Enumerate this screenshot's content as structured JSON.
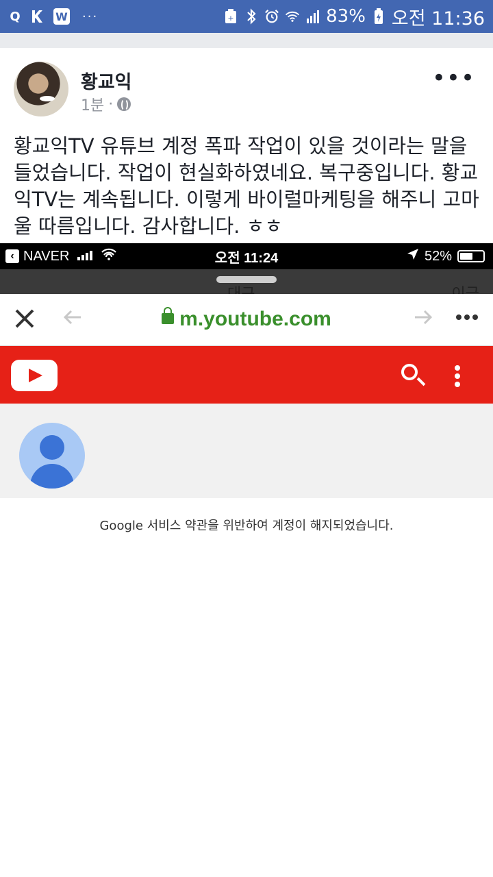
{
  "status_bar": {
    "apps": [
      "Q",
      "W"
    ],
    "more": "···",
    "battery": "83%",
    "time": "오전 11:36"
  },
  "post": {
    "author": "황교익",
    "time": "1분",
    "separator": "·",
    "more": "•••",
    "text": "황교익TV 유튜브 계정 폭파 작업이 있을 것이라는 말을 들었습니다. 작업이 현실화하였네요. 복구중입니다. 황교익TV는 계속됩니다. 이렇게 바이럴마케팅을 해주니 고마울 따름입니다. 감사합니다. ㅎㅎ"
  },
  "screenshot": {
    "status_bar": {
      "carrier": "NAVER",
      "time": "오전 11:24",
      "battery": "52%"
    },
    "peek_left": "대구",
    "peek_right": "이긍",
    "browser": {
      "url": "m.youtube.com"
    },
    "message": "Google 서비스 약관을 위반하여 계정이 해지되었습니다."
  },
  "icons": {
    "status": [
      "search-q-icon",
      "k-app-icon",
      "w-app-icon",
      "data-saver-icon",
      "bluetooth-icon",
      "alarm-icon",
      "wifi-icon",
      "signal-icon",
      "battery-icon"
    ],
    "browser": [
      "close-icon",
      "back-arrow-icon",
      "lock-icon",
      "forward-arrow-icon",
      "more-icon",
      "youtube-logo-icon",
      "search-icon",
      "kebab-icon"
    ]
  }
}
